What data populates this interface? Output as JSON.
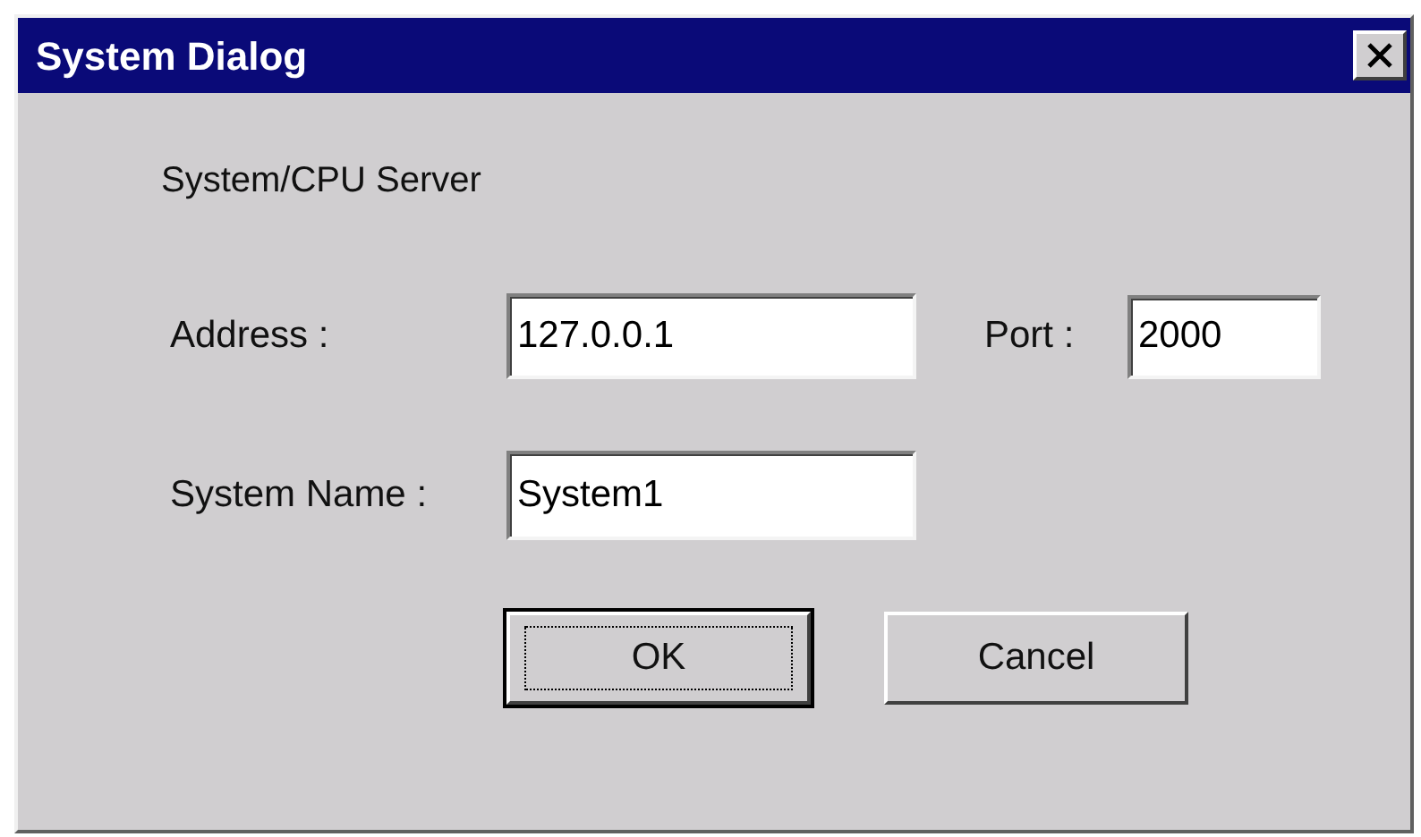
{
  "window": {
    "title": "System Dialog"
  },
  "heading": "System/CPU Server",
  "fields": [
    {
      "label": "Address :",
      "value": "127.0.0.1"
    },
    {
      "label": "Port :",
      "value": "2000"
    },
    {
      "label": "System Name :",
      "value": "System1"
    }
  ],
  "buttons": [
    {
      "label": "OK",
      "default": true
    },
    {
      "label": "Cancel",
      "default": false
    }
  ]
}
